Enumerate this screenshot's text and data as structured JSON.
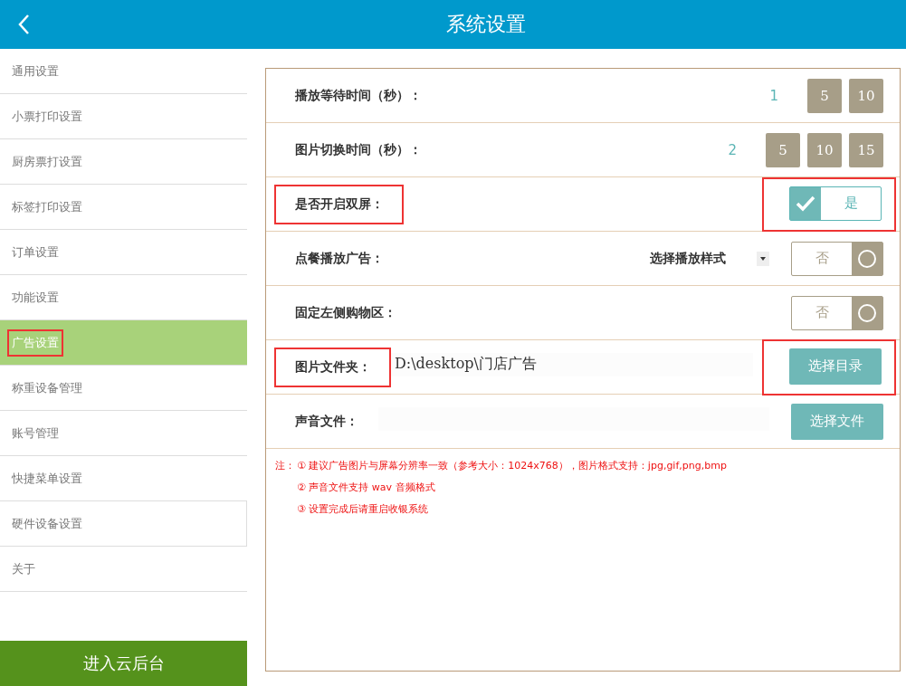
{
  "header": {
    "title": "系统设置"
  },
  "sidebar": {
    "items": [
      {
        "label": "通用设置",
        "selected": false,
        "marked": false
      },
      {
        "label": "小票打印设置",
        "selected": false,
        "marked": false
      },
      {
        "label": "厨房票打设置",
        "selected": false,
        "marked": false
      },
      {
        "label": "标签打印设置",
        "selected": false,
        "marked": false
      },
      {
        "label": "订单设置",
        "selected": false,
        "marked": false
      },
      {
        "label": "功能设置",
        "selected": false,
        "marked": false
      },
      {
        "label": "广告设置",
        "selected": true,
        "marked": true
      },
      {
        "label": "称重设备管理",
        "selected": false,
        "marked": false
      },
      {
        "label": "账号管理",
        "selected": false,
        "marked": false
      },
      {
        "label": "快捷菜单设置",
        "selected": false,
        "marked": false
      },
      {
        "label": "硬件设备设置",
        "selected": false,
        "marked": false
      },
      {
        "label": "关于",
        "selected": false,
        "marked": false
      }
    ],
    "footer_button": "进入云后台"
  },
  "settings": [
    {
      "kind": "options",
      "label": "播放等待时间（秒）：",
      "label_marked": false,
      "control_marked": false,
      "current": "1",
      "options": [
        "5",
        "10"
      ]
    },
    {
      "kind": "options",
      "label": "图片切换时间（秒）：",
      "label_marked": false,
      "control_marked": false,
      "current": "2",
      "options": [
        "5",
        "10",
        "15"
      ]
    },
    {
      "kind": "toggle",
      "label": "是否开启双屏：",
      "label_marked": true,
      "control_marked": true,
      "on": true,
      "state_text": "是"
    },
    {
      "kind": "toggle",
      "label": "点餐播放广告：",
      "label_marked": false,
      "control_marked": false,
      "select": "选择播放样式",
      "on": false,
      "state_text": "否"
    },
    {
      "kind": "toggle",
      "label": "固定左侧购物区：",
      "label_marked": false,
      "control_marked": false,
      "on": false,
      "state_text": "否"
    },
    {
      "kind": "path",
      "label": "图片文件夹：",
      "label_marked": true,
      "control_marked": true,
      "value": "D:\\desktop\\门店广告",
      "button": "选择目录"
    },
    {
      "kind": "path",
      "label": "声音文件：",
      "label_marked": false,
      "control_marked": false,
      "button": "选择文件"
    }
  ],
  "notes": {
    "prefix": "注：",
    "lines": [
      "① 建议广告图片与屏幕分辨率一致（参考大小：1024x768），图片格式支持：jpg,gif,png,bmp",
      "② 声音文件支持 wav 音频格式",
      "③ 设置完成后请重启收银系统"
    ]
  }
}
